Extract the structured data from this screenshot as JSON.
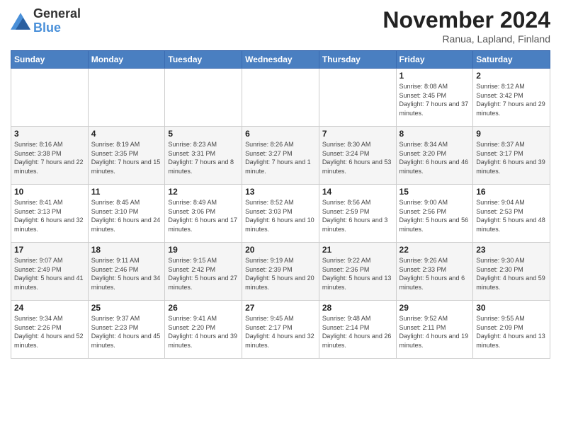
{
  "header": {
    "logo_general": "General",
    "logo_blue": "Blue",
    "month_title": "November 2024",
    "location": "Ranua, Lapland, Finland"
  },
  "weekdays": [
    "Sunday",
    "Monday",
    "Tuesday",
    "Wednesday",
    "Thursday",
    "Friday",
    "Saturday"
  ],
  "weeks": [
    [
      {
        "day": "",
        "info": ""
      },
      {
        "day": "",
        "info": ""
      },
      {
        "day": "",
        "info": ""
      },
      {
        "day": "",
        "info": ""
      },
      {
        "day": "",
        "info": ""
      },
      {
        "day": "1",
        "info": "Sunrise: 8:08 AM\nSunset: 3:45 PM\nDaylight: 7 hours and 37 minutes."
      },
      {
        "day": "2",
        "info": "Sunrise: 8:12 AM\nSunset: 3:42 PM\nDaylight: 7 hours and 29 minutes."
      }
    ],
    [
      {
        "day": "3",
        "info": "Sunrise: 8:16 AM\nSunset: 3:38 PM\nDaylight: 7 hours and 22 minutes."
      },
      {
        "day": "4",
        "info": "Sunrise: 8:19 AM\nSunset: 3:35 PM\nDaylight: 7 hours and 15 minutes."
      },
      {
        "day": "5",
        "info": "Sunrise: 8:23 AM\nSunset: 3:31 PM\nDaylight: 7 hours and 8 minutes."
      },
      {
        "day": "6",
        "info": "Sunrise: 8:26 AM\nSunset: 3:27 PM\nDaylight: 7 hours and 1 minute."
      },
      {
        "day": "7",
        "info": "Sunrise: 8:30 AM\nSunset: 3:24 PM\nDaylight: 6 hours and 53 minutes."
      },
      {
        "day": "8",
        "info": "Sunrise: 8:34 AM\nSunset: 3:20 PM\nDaylight: 6 hours and 46 minutes."
      },
      {
        "day": "9",
        "info": "Sunrise: 8:37 AM\nSunset: 3:17 PM\nDaylight: 6 hours and 39 minutes."
      }
    ],
    [
      {
        "day": "10",
        "info": "Sunrise: 8:41 AM\nSunset: 3:13 PM\nDaylight: 6 hours and 32 minutes."
      },
      {
        "day": "11",
        "info": "Sunrise: 8:45 AM\nSunset: 3:10 PM\nDaylight: 6 hours and 24 minutes."
      },
      {
        "day": "12",
        "info": "Sunrise: 8:49 AM\nSunset: 3:06 PM\nDaylight: 6 hours and 17 minutes."
      },
      {
        "day": "13",
        "info": "Sunrise: 8:52 AM\nSunset: 3:03 PM\nDaylight: 6 hours and 10 minutes."
      },
      {
        "day": "14",
        "info": "Sunrise: 8:56 AM\nSunset: 2:59 PM\nDaylight: 6 hours and 3 minutes."
      },
      {
        "day": "15",
        "info": "Sunrise: 9:00 AM\nSunset: 2:56 PM\nDaylight: 5 hours and 56 minutes."
      },
      {
        "day": "16",
        "info": "Sunrise: 9:04 AM\nSunset: 2:53 PM\nDaylight: 5 hours and 48 minutes."
      }
    ],
    [
      {
        "day": "17",
        "info": "Sunrise: 9:07 AM\nSunset: 2:49 PM\nDaylight: 5 hours and 41 minutes."
      },
      {
        "day": "18",
        "info": "Sunrise: 9:11 AM\nSunset: 2:46 PM\nDaylight: 5 hours and 34 minutes."
      },
      {
        "day": "19",
        "info": "Sunrise: 9:15 AM\nSunset: 2:42 PM\nDaylight: 5 hours and 27 minutes."
      },
      {
        "day": "20",
        "info": "Sunrise: 9:19 AM\nSunset: 2:39 PM\nDaylight: 5 hours and 20 minutes."
      },
      {
        "day": "21",
        "info": "Sunrise: 9:22 AM\nSunset: 2:36 PM\nDaylight: 5 hours and 13 minutes."
      },
      {
        "day": "22",
        "info": "Sunrise: 9:26 AM\nSunset: 2:33 PM\nDaylight: 5 hours and 6 minutes."
      },
      {
        "day": "23",
        "info": "Sunrise: 9:30 AM\nSunset: 2:30 PM\nDaylight: 4 hours and 59 minutes."
      }
    ],
    [
      {
        "day": "24",
        "info": "Sunrise: 9:34 AM\nSunset: 2:26 PM\nDaylight: 4 hours and 52 minutes."
      },
      {
        "day": "25",
        "info": "Sunrise: 9:37 AM\nSunset: 2:23 PM\nDaylight: 4 hours and 45 minutes."
      },
      {
        "day": "26",
        "info": "Sunrise: 9:41 AM\nSunset: 2:20 PM\nDaylight: 4 hours and 39 minutes."
      },
      {
        "day": "27",
        "info": "Sunrise: 9:45 AM\nSunset: 2:17 PM\nDaylight: 4 hours and 32 minutes."
      },
      {
        "day": "28",
        "info": "Sunrise: 9:48 AM\nSunset: 2:14 PM\nDaylight: 4 hours and 26 minutes."
      },
      {
        "day": "29",
        "info": "Sunrise: 9:52 AM\nSunset: 2:11 PM\nDaylight: 4 hours and 19 minutes."
      },
      {
        "day": "30",
        "info": "Sunrise: 9:55 AM\nSunset: 2:09 PM\nDaylight: 4 hours and 13 minutes."
      }
    ]
  ]
}
